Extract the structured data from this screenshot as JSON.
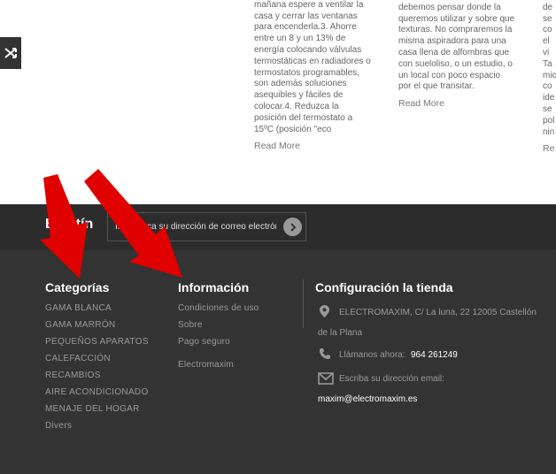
{
  "posts": [
    {
      "text": "mientras duerme y por la\nmañana espere a ventilar la\ncasa y cerrar las ventanas\npara encenderla.3. Ahorre\nentre un 8 y un 13% de\nenergía colocando válvulas\ntermostáticas en radiadores o\ntermostatos programables,\nson además soluciones\nasequibles y fáciles de\ncolocar.4. Reduzca la\nposición del termostato a\n15ºC (posición \"eco",
      "read_more": "Read More"
    },
    {
      "text": "sin ella, etc.Antes de todo\ndebemos pensar donde la\nqueremos utilizar y sobre que\ntexturas. No compraremos la\nmisma aspiradora para una\ncasa llena de alfombras que\ncon sueloliso, o un estudio, o\nun local con poco espacio\npor el que transitar.",
      "read_more": "Read More"
    },
    {
      "text": "as\nde\nse\nco\nel\nvi\nTa\nmic\nco\nide\nse\npol\nnin",
      "read_more": "Re"
    }
  ],
  "newsletter": {
    "title": "Boletín",
    "placeholder": "Introduzca su dirección de correo electrónico"
  },
  "footer": {
    "categories": {
      "title": "Categorías",
      "items": [
        "GAMA BLANCA",
        "GAMA MARRÓN",
        "PEQUEÑOS APARATOS",
        "CALEFACCIÓN",
        "RECAMBIOS",
        "AIRE ACONDICIONADO",
        "MENAJE DEL HOGAR",
        "Divers"
      ]
    },
    "information": {
      "title": "Información",
      "items": [
        "Condiciones de uso",
        "Sobre",
        "Pago seguro",
        "Electromaxim"
      ]
    },
    "store": {
      "title": "Configuración la tienda",
      "address_line1": "ELECTROMAXIM, C/ La luna, 22 12005 Castellón",
      "address_line2": "de la Plana",
      "phone_label": "Llámanos ahora:",
      "phone": "964 261249",
      "email_label": "Escriba su dirección email:",
      "email": "maxim@electromaxim.es"
    }
  },
  "colors": {
    "arrow": "#e00000",
    "footer_bg": "#333333",
    "newsletter_bg": "#2c2c2c"
  }
}
